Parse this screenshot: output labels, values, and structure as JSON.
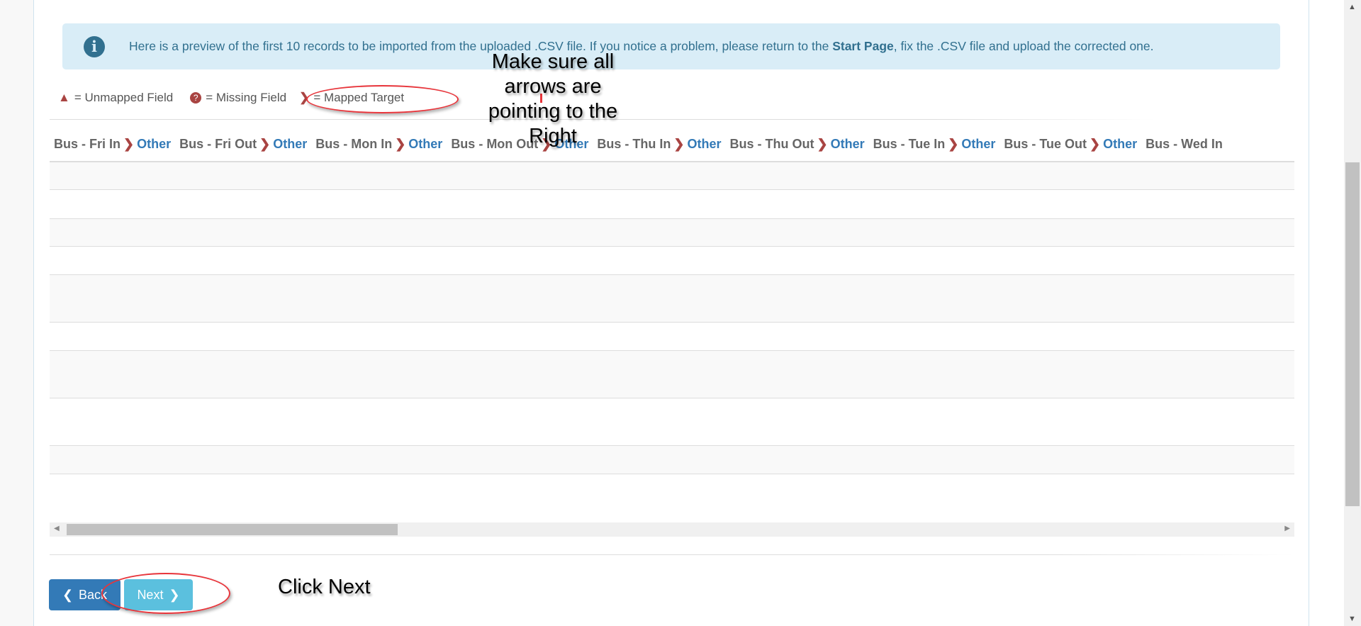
{
  "alert": {
    "icon": "info-circle-icon",
    "text_before": "Here is a preview of the first 10 records to be imported from the uploaded .CSV file. If you notice a problem, please return to the ",
    "link": "Start Page",
    "text_after": ", fix the .CSV file and upload the corrected one."
  },
  "legend": {
    "unmapped": "= Unmapped Field",
    "missing": "= Missing Field",
    "mapped": "= Mapped Target"
  },
  "columns": [
    {
      "source": "Bus - Fri In",
      "target": "Other"
    },
    {
      "source": "Bus - Fri Out",
      "target": "Other"
    },
    {
      "source": "Bus - Mon In",
      "target": "Other"
    },
    {
      "source": "Bus - Mon Out",
      "target": "Other"
    },
    {
      "source": "Bus - Thu In",
      "target": "Other"
    },
    {
      "source": "Bus - Thu Out",
      "target": "Other"
    },
    {
      "source": "Bus - Tue In",
      "target": "Other"
    },
    {
      "source": "Bus - Tue Out",
      "target": "Other"
    },
    {
      "source": "Bus - Wed In",
      "target": ""
    }
  ],
  "buttons": {
    "back": "Back",
    "next": "Next"
  },
  "annotations": {
    "arrows_note": [
      "Make sure all",
      "arrows are",
      "pointing to the",
      "Right"
    ],
    "next_note": "Click Next"
  },
  "colors": {
    "arrow": "#a94442",
    "target": "#337ab7",
    "back": "#337ab7",
    "next": "#5bc0de",
    "annotation": "#e8353b"
  }
}
